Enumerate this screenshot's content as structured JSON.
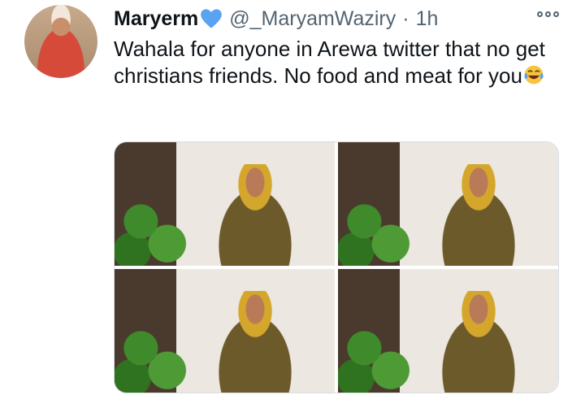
{
  "tweet": {
    "display_name": "Maryerm",
    "handle": "@_MaryamWaziry",
    "separator": "·",
    "time": "1h",
    "text": "Wahala for anyone in Arewa twitter that no get christians friends. No food and meat for you",
    "emoji": "face-with-tears-of-joy",
    "verified_icon": "blue-heart-icon",
    "media_count": 4
  },
  "colors": {
    "text": "#0f1419",
    "secondary": "#536471",
    "heart": "#5aa3f0"
  }
}
